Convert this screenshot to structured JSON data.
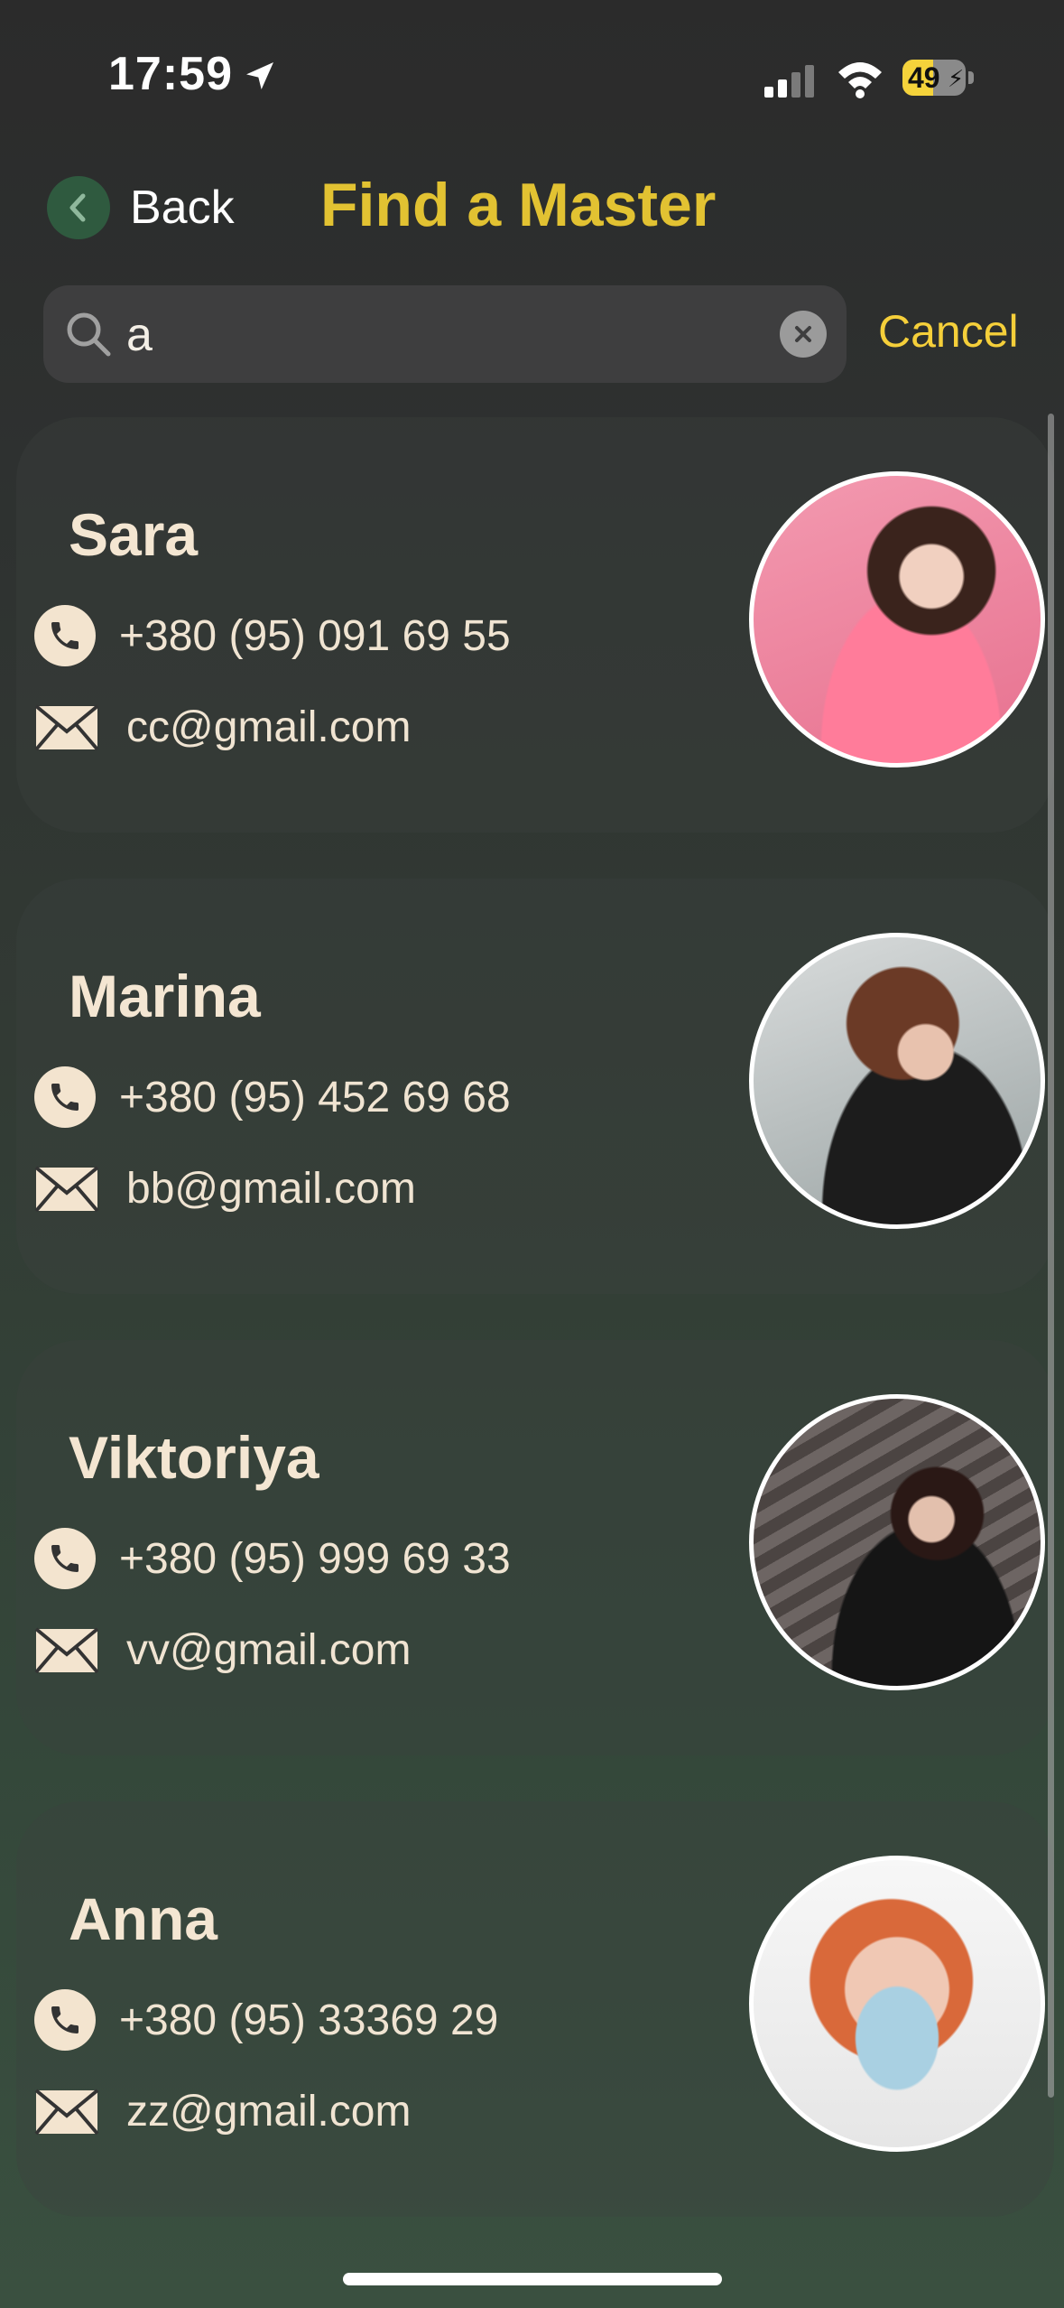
{
  "status_bar": {
    "time": "17:59",
    "battery": "49"
  },
  "nav": {
    "back_label": "Back",
    "title": "Find a Master"
  },
  "search": {
    "value": "a",
    "cancel_label": "Cancel"
  },
  "masters": [
    {
      "name": "Sara",
      "phone": "+380 (95) 091 69 55",
      "email": "cc@gmail.com"
    },
    {
      "name": "Marina",
      "phone": "+380 (95) 452 69 68",
      "email": "bb@gmail.com"
    },
    {
      "name": "Viktoriya",
      "phone": "+380 (95) 999 69 33",
      "email": "vv@gmail.com"
    },
    {
      "name": "Anna",
      "phone": "+380 (95) 33369 29",
      "email": "zz@gmail.com"
    }
  ],
  "colors": {
    "accent": "#e2c232",
    "cancel": "#f5cf3a",
    "text": "#f1e3cf"
  }
}
